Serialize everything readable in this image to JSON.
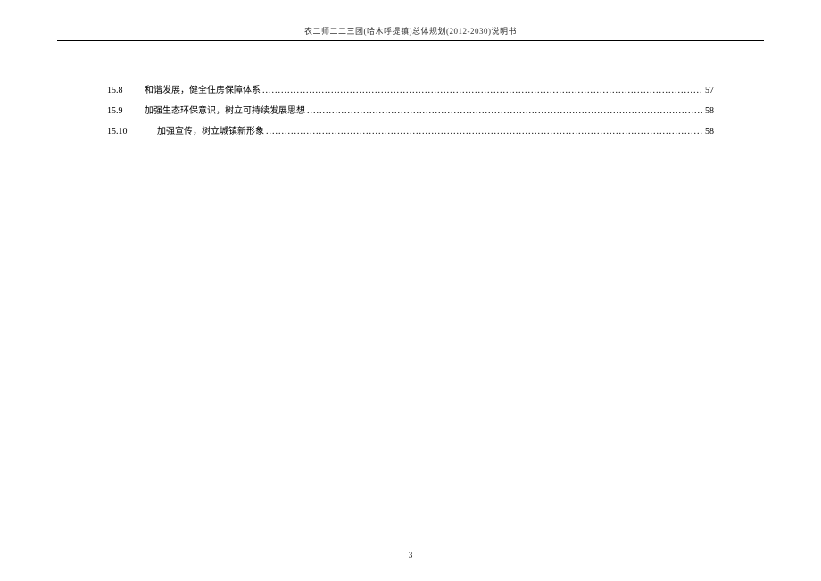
{
  "header": {
    "title": "农二师二二三团(哈木呼提镇)总体规划(2012-2030)说明书"
  },
  "toc": {
    "items": [
      {
        "num": "15.8",
        "title": "和谐发展，健全住房保障体系",
        "page": "57",
        "wide": false
      },
      {
        "num": "15.9",
        "title": "加强生态环保意识，树立可持续发展思想",
        "page": "58",
        "wide": false
      },
      {
        "num": "15.10",
        "title": "加强宣传，树立城镇新形象",
        "page": "58",
        "wide": true
      }
    ]
  },
  "footer": {
    "pageNumber": "3"
  }
}
